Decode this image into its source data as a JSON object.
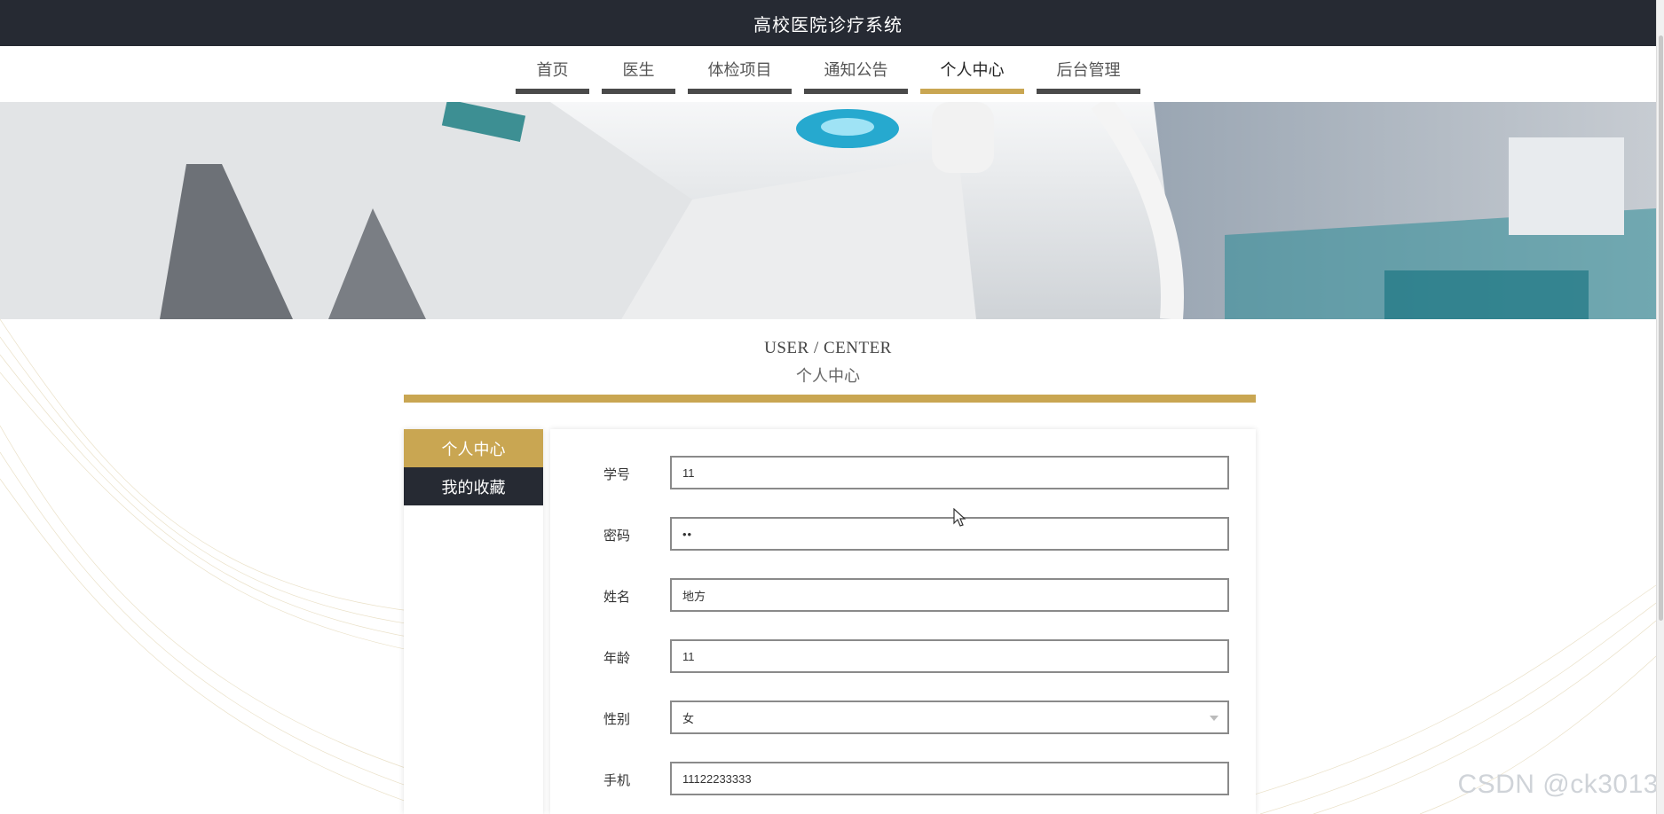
{
  "header": {
    "title": "高校医院诊疗系统"
  },
  "nav": {
    "items": [
      {
        "label": "首页",
        "active": false
      },
      {
        "label": "医生",
        "active": false
      },
      {
        "label": "体检项目",
        "active": false
      },
      {
        "label": "通知公告",
        "active": false
      },
      {
        "label": "个人中心",
        "active": true
      },
      {
        "label": "后台管理",
        "active": false
      }
    ]
  },
  "section": {
    "title_en": "USER / CENTER",
    "title_cn": "个人中心"
  },
  "sidebar": {
    "items": [
      {
        "label": "个人中心",
        "active": true
      },
      {
        "label": "我的收藏",
        "active": false
      }
    ]
  },
  "form": {
    "student_id": {
      "label": "学号",
      "value": "11"
    },
    "password": {
      "label": "密码",
      "value": "••"
    },
    "name": {
      "label": "姓名",
      "value": "地方"
    },
    "age": {
      "label": "年龄",
      "value": "11"
    },
    "gender": {
      "label": "性别",
      "value": "女"
    },
    "phone": {
      "label": "手机",
      "value": "11122233333"
    }
  },
  "watermark": "CSDN @ck3013",
  "colors": {
    "accent": "#c9a652",
    "dark": "#262a33"
  }
}
